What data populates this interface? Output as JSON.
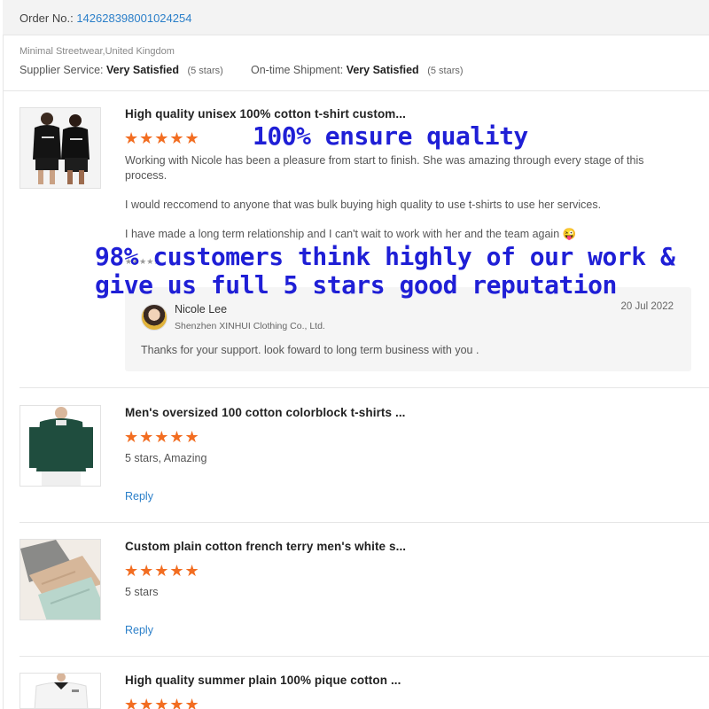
{
  "order": {
    "label": "Order No.:",
    "number": "142628398001024254"
  },
  "supplier": {
    "location": "Minimal Streetwear,United Kingdom",
    "supplier_service": {
      "label": "Supplier Service:",
      "value": "Very Satisfied",
      "note": "(5 stars)"
    },
    "ontime_shipment": {
      "label": "On-time Shipment:",
      "value": "Very Satisfied",
      "note": "(5 stars)"
    }
  },
  "overlays": {
    "quality": "100% ensure quality",
    "customers_line1": "98% customers think highly of our work &",
    "customers_line2": "give us full 5 stars good reputation"
  },
  "reviews": [
    {
      "title": "High quality unisex 100% cotton t-shirt custom...",
      "stars": "★★★★★",
      "rating": 5,
      "paragraphs": [
        "Working with Nicole has been a pleasure from start to finish. She was amazing through every stage of this",
        "process.",
        "I would reccomend to anyone that was bulk buying high quality to use t-shirts to use her services.",
        "I have made a long term relationship and I can't wait to work with her and the team again 😜"
      ],
      "small_stars": "★★★★★",
      "reply": {
        "name": "Nicole Lee",
        "company": "Shenzhen XINHUI Clothing Co., Ltd.",
        "date": "20 Jul 2022",
        "message": "Thanks for your support. look foward to long term business with you ."
      }
    },
    {
      "title": "Men's oversized 100 cotton colorblock t-shirts ...",
      "stars": "★★★★★",
      "rating": 5,
      "text": "5 stars, Amazing",
      "reply_label": "Reply"
    },
    {
      "title": "Custom plain cotton french terry men's white s...",
      "stars": "★★★★★",
      "rating": 5,
      "text": "5 stars",
      "reply_label": "Reply"
    },
    {
      "title": "High quality summer plain 100% pique cotton ...",
      "stars": "★★★★★",
      "rating": 5
    }
  ]
}
